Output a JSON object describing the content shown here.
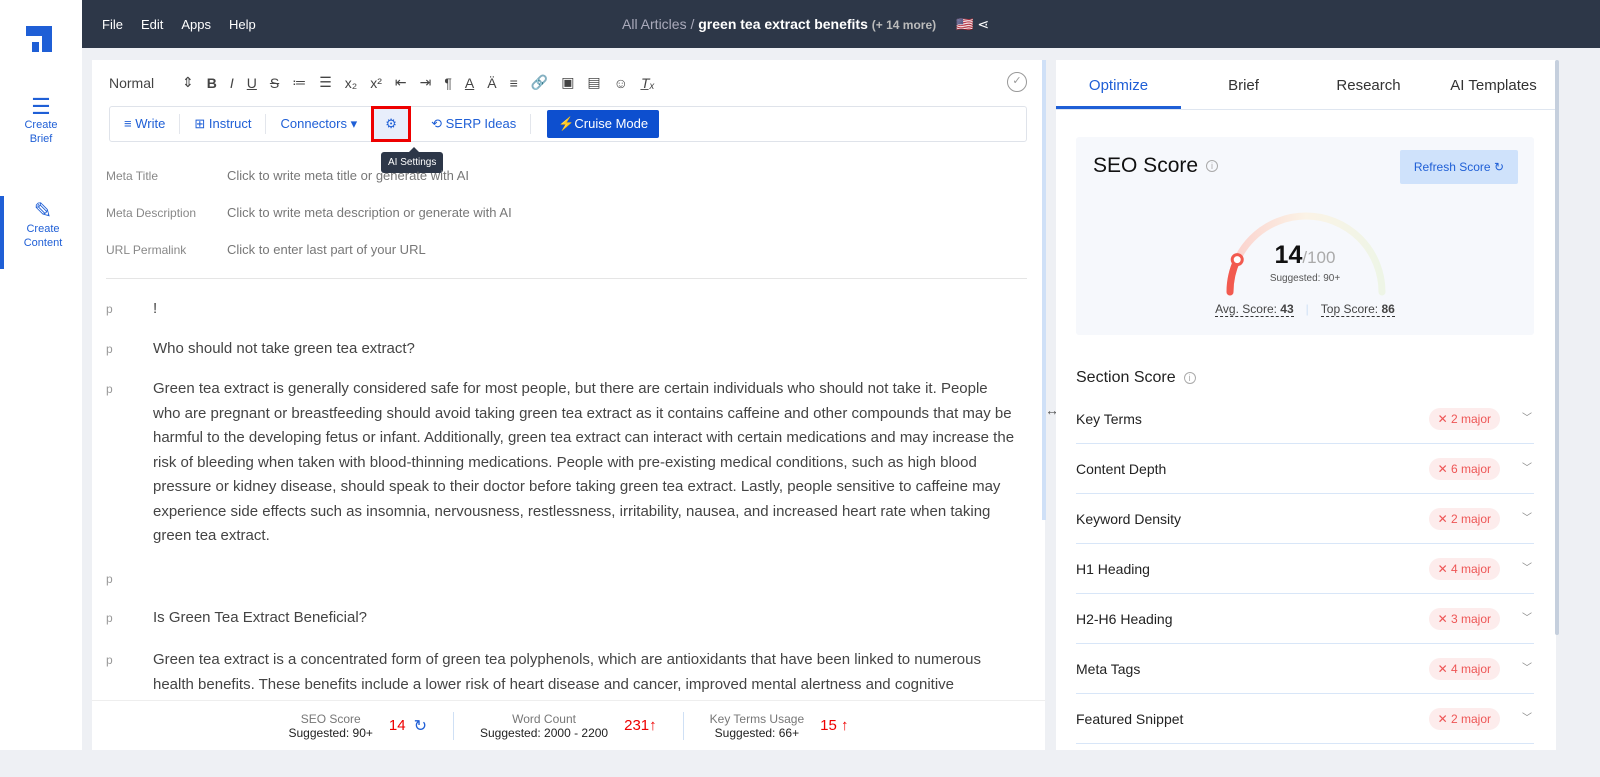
{
  "sidebar": {
    "items": [
      {
        "label": "Create Brief"
      },
      {
        "label": "Create Content"
      }
    ]
  },
  "topbar": {
    "menu": [
      "File",
      "Edit",
      "Apps",
      "Help"
    ],
    "breadcrumb_root": "All Articles",
    "separator": "/",
    "title": "green tea extract benefits",
    "more": "(+ 14 more)",
    "flag": "🇺🇸"
  },
  "toolbar": {
    "style": "Normal",
    "ai": {
      "write": "Write",
      "instruct": "Instruct",
      "connectors": "Connectors",
      "serp": "SERP Ideas",
      "cruise": "Cruise Mode",
      "tooltip": "AI Settings"
    }
  },
  "meta": [
    {
      "label": "Meta Title",
      "placeholder": "Click to write meta title or generate with AI"
    },
    {
      "label": "Meta Description",
      "placeholder": "Click to write meta description or generate with AI"
    },
    {
      "label": "URL Permalink",
      "placeholder": "Click to enter last part of your URL"
    }
  ],
  "content": [
    {
      "tag": "p",
      "text": "!"
    },
    {
      "tag": "p",
      "text": "Who should not take green tea extract?"
    },
    {
      "tag": "p",
      "text": "Green tea extract is generally considered safe for most people, but there are certain individuals who should not take it. People who are pregnant or breastfeeding should avoid taking green tea extract as it contains caffeine and other compounds that may be harmful to the developing fetus or infant. Additionally, green tea extract can interact with certain medications and may increase the risk of bleeding when taken with blood-thinning medications. People with pre-existing medical conditions, such as high blood pressure or kidney disease, should speak to their doctor before taking green tea extract. Lastly, people sensitive to caffeine may experience side effects such as insomnia, nervousness, restlessness, irritability, nausea, and increased heart rate when taking green tea extract."
    },
    {
      "tag": "p",
      "text": ""
    },
    {
      "tag": "p",
      "text": "Is Green Tea Extract Beneficial?"
    },
    {
      "tag": "p",
      "text": "Green tea extract is a concentrated form of green tea polyphenols, which are antioxidants that have been linked to numerous health benefits. These benefits include a lower risk of heart disease and cancer, improved mental alertness and cognitive"
    }
  ],
  "footer": [
    {
      "label": "SEO Score",
      "suggested": "Suggested: 90+",
      "value": "14"
    },
    {
      "label": "Word Count",
      "suggested": "Suggested: 2000 - 2200",
      "value": "231↑"
    },
    {
      "label": "Key Terms Usage",
      "suggested": "Suggested: 66+",
      "value": "15 ↑"
    }
  ],
  "panel": {
    "tabs": [
      "Optimize",
      "Brief",
      "Research",
      "AI Templates"
    ],
    "seo": {
      "title": "SEO Score",
      "refresh": "Refresh Score",
      "score": "14",
      "max": "/100",
      "score_value": 14,
      "suggested": "Suggested: 90+",
      "avg_label": "Avg. Score:",
      "avg": "43",
      "top_label": "Top Score:",
      "top": "86"
    },
    "section_title": "Section Score",
    "sections": [
      {
        "name": "Key Terms",
        "badge": "2 major"
      },
      {
        "name": "Content Depth",
        "badge": "6 major"
      },
      {
        "name": "Keyword Density",
        "badge": "2 major"
      },
      {
        "name": "H1 Heading",
        "badge": "4 major"
      },
      {
        "name": "H2-H6 Heading",
        "badge": "3 major"
      },
      {
        "name": "Meta Tags",
        "badge": "4 major"
      },
      {
        "name": "Featured Snippet",
        "badge": "2 major"
      }
    ]
  }
}
